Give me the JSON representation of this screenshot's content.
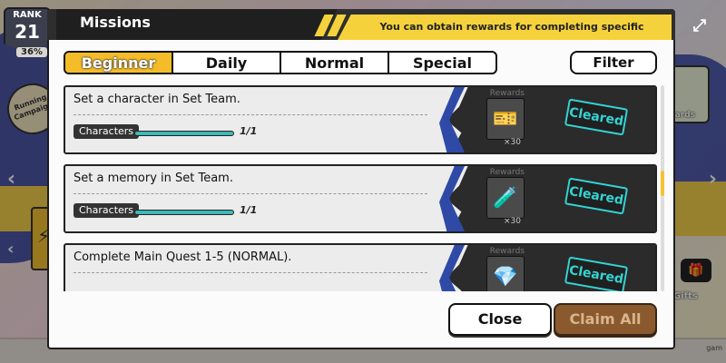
{
  "background": {
    "rank_label": "RANK",
    "rank_value": "21",
    "rank_percent": "36%",
    "event_label": "Running Campaign",
    "rewards_label": "Rewards",
    "gifts_label": "Gifts",
    "corner_tag": "gam"
  },
  "modal": {
    "title": "Missions",
    "info": "You can obtain rewards for completing specific missions."
  },
  "tabs": [
    "Beginner",
    "Daily",
    "Normal",
    "Special"
  ],
  "active_tab": "Beginner",
  "filter_label": "Filter",
  "missions": [
    {
      "text": "Set a character in Set Team.",
      "category": "Characters",
      "progress": "1/1",
      "progress_fraction": 1.0,
      "rewards_label": "Rewards",
      "reward_qty": "×30",
      "reward_icon": "ticket-icon",
      "status": "Cleared"
    },
    {
      "text": "Set a memory in Set Team.",
      "category": "Characters",
      "progress": "1/1",
      "progress_fraction": 1.0,
      "rewards_label": "Rewards",
      "reward_qty": "×30",
      "reward_icon": "stamina-drink-icon",
      "status": "Cleared"
    },
    {
      "text": "Complete Main Quest 1-5 (NORMAL).",
      "category": "",
      "progress": "",
      "rewards_label": "Rewards",
      "reward_icon": "gem-icon",
      "status": "Cleared"
    }
  ],
  "buttons": {
    "close": "Close",
    "claim_all": "Claim All"
  },
  "colors": {
    "accent_yellow": "#f5d23c",
    "tab_active": "#f5bc2a",
    "cleared": "#34d3d3",
    "progress_bar": "#3fb8b8",
    "claim_all_disabled": "#8a5a2e"
  }
}
